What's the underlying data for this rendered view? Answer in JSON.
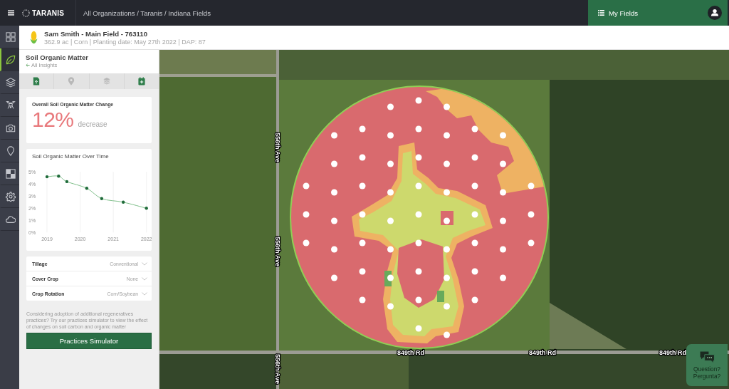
{
  "top_bar": {
    "logo": "TARANIS",
    "breadcrumb": "All Organizations / Taranis / Indiana Fields",
    "my_fields": "My Fields"
  },
  "rail": [
    {
      "kind": "grid",
      "selected": false
    },
    {
      "kind": "leaf",
      "selected": true
    },
    {
      "kind": "layers",
      "selected": false
    },
    {
      "kind": "drone",
      "selected": false
    },
    {
      "kind": "camera",
      "selected": false
    },
    {
      "kind": "pin",
      "selected": false
    },
    {
      "kind": "checker",
      "selected": false
    },
    {
      "kind": "gear",
      "selected": false
    },
    {
      "kind": "cloud",
      "selected": false
    }
  ],
  "field_header": {
    "title": "Sam Smith - Main Field - 763110",
    "details": "362.9 ac | Corn | Planting date: May 27th 2022 | DAP: 87"
  },
  "panel": {
    "title": "Soil Organic Matter",
    "back_link": "All Insights",
    "tools": [
      {
        "kind": "report",
        "disabled": false
      },
      {
        "kind": "pin",
        "disabled": true
      },
      {
        "kind": "layers",
        "disabled": true
      },
      {
        "kind": "calendar",
        "disabled": false
      }
    ],
    "change_card": {
      "title": "Overall Soil Organic Matter Change",
      "value": "12%",
      "change_label": "decrease"
    },
    "trend_card": {
      "title": "Soil Organic Matter Over Time",
      "chart_data": {
        "type": "line",
        "x": [
          2019,
          2019.35,
          2019.6,
          2020.2,
          2020.65,
          2021.3,
          2022
        ],
        "values": [
          4.6,
          4.65,
          4.2,
          3.65,
          2.8,
          2.5,
          2.0
        ],
        "xlim": [
          2019,
          2022
        ],
        "ylim": [
          0,
          5
        ],
        "xticks": [
          2019,
          2020,
          2021,
          2022
        ],
        "yticks": [
          {
            "value": 0,
            "label": "0%"
          },
          {
            "value": 1,
            "label": "1%"
          },
          {
            "value": 2,
            "label": "2%"
          },
          {
            "value": 3,
            "label": "3%"
          },
          {
            "value": 4,
            "label": "4%"
          },
          {
            "value": 5,
            "label": "5%"
          }
        ],
        "grid": true
      }
    },
    "practices": [
      {
        "label": "Tillage",
        "value": "Conventional"
      },
      {
        "label": "Cover Crop",
        "value": "None"
      },
      {
        "label": "Crop Rotation",
        "value": "Corn/Soybean"
      }
    ],
    "note": "Considering adoption of additional regeneratives practices? Try our practices simulator to view the effect of changes on soil carbon and organic matter",
    "button": "Practices Simulator"
  },
  "map": {
    "road_labels": [
      {
        "text": "556th Ave",
        "kind": "vertical"
      },
      {
        "text": "556th Ave",
        "kind": "vertical"
      },
      {
        "text": "556th Ave",
        "kind": "vertical"
      },
      {
        "text": "849th Rd",
        "kind": "horizontal"
      },
      {
        "text": "849th Rd",
        "kind": "horizontal"
      },
      {
        "text": "849th Rd",
        "kind": "horizontal"
      }
    ]
  },
  "chat_button": {
    "lines": [
      "Question?",
      "Pergunta?"
    ]
  }
}
